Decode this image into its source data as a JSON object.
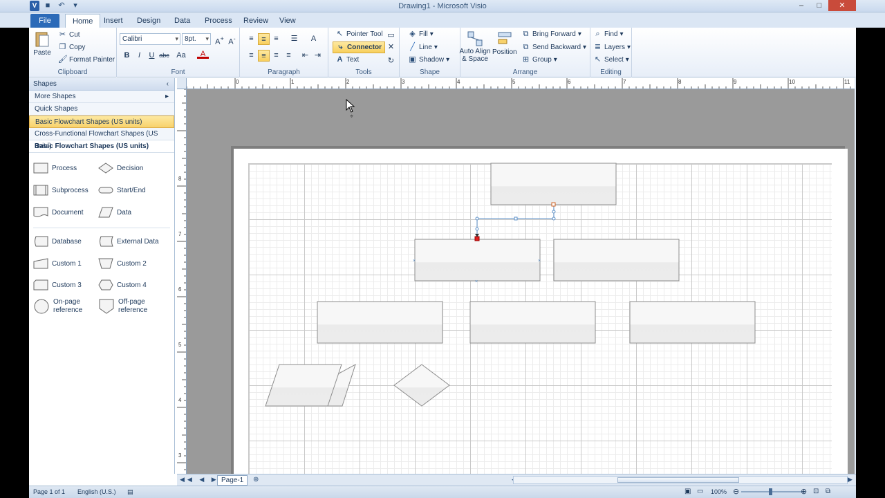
{
  "window": {
    "title": "Drawing1 - Microsoft Visio",
    "app_letter": "V",
    "controls": [
      "–",
      "□",
      "✕"
    ]
  },
  "tabs": [
    {
      "label": "File"
    },
    {
      "label": "Home"
    },
    {
      "label": "Insert"
    },
    {
      "label": "Design"
    },
    {
      "label": "Data"
    },
    {
      "label": "Process"
    },
    {
      "label": "Review"
    },
    {
      "label": "View"
    }
  ],
  "ribbon": {
    "clipboard": {
      "label": "Clipboard",
      "paste": "Paste",
      "cut": "Cut",
      "copy": "Copy",
      "format_painter": "Format Painter"
    },
    "font": {
      "label": "Font",
      "family": "Calibri",
      "size": "8pt.",
      "bold": "B",
      "italic": "I",
      "underline": "U",
      "strike": "abc",
      "case": "Aa",
      "color": "A"
    },
    "paragraph": {
      "label": "Paragraph"
    },
    "tools": {
      "label": "Tools",
      "pointer": "Pointer Tool",
      "connector": "Connector",
      "text": "Text"
    },
    "shape": {
      "label": "Shape",
      "fill": "Fill",
      "line": "Line",
      "shadow": "Shadow"
    },
    "arrange": {
      "label": "Arrange",
      "auto_align_1": "Auto Align",
      "auto_align_2": "& Space",
      "position": "Position",
      "bring_forward": "Bring Forward",
      "send_backward": "Send Backward",
      "group": "Group"
    },
    "editing": {
      "label": "Editing",
      "find": "Find",
      "layers": "Layers",
      "select": "Select"
    }
  },
  "shapes_pane": {
    "header": "Shapes",
    "rows": [
      {
        "label": "More Shapes"
      },
      {
        "label": "Quick Shapes"
      },
      {
        "label": "Basic Flowchart Shapes (US units)"
      },
      {
        "label": "Cross-Functional Flowchart Shapes (US units)"
      }
    ],
    "stencil_title": "Basic Flowchart Shapes (US units)",
    "items": [
      {
        "label": "Process",
        "icon": "process-icon"
      },
      {
        "label": "Decision",
        "icon": "decision-icon"
      },
      {
        "label": "Subprocess",
        "icon": "subprocess-icon"
      },
      {
        "label": "Start/End",
        "icon": "start-end-icon"
      },
      {
        "label": "Document",
        "icon": "document-icon"
      },
      {
        "label": "Data",
        "icon": "data-icon"
      },
      {
        "label": "Database",
        "icon": "database-icon"
      },
      {
        "label": "External Data",
        "icon": "external-data-icon"
      },
      {
        "label": "Custom 1",
        "icon": "custom1-icon"
      },
      {
        "label": "Custom 2",
        "icon": "custom2-icon"
      },
      {
        "label": "Custom 3",
        "icon": "custom3-icon"
      },
      {
        "label": "Custom 4",
        "icon": "custom4-icon"
      },
      {
        "label": "On-page",
        "label2": "reference",
        "icon": "on-page-reference-icon"
      },
      {
        "label": "Off-page",
        "label2": "reference",
        "icon": "off-page-reference-icon"
      }
    ]
  },
  "ruler": {
    "top_labels": [
      "0",
      "1",
      "2",
      "3",
      "4",
      "5",
      "6",
      "7",
      "8",
      "9",
      "10",
      "11"
    ],
    "left_labels": [
      "8",
      "7",
      "6",
      "5",
      "4",
      "3"
    ]
  },
  "page_tabs": {
    "current": "Page-1"
  },
  "status": {
    "page": "Page 1 of 1",
    "language": "English (U.S.)",
    "zoom": "100%"
  }
}
